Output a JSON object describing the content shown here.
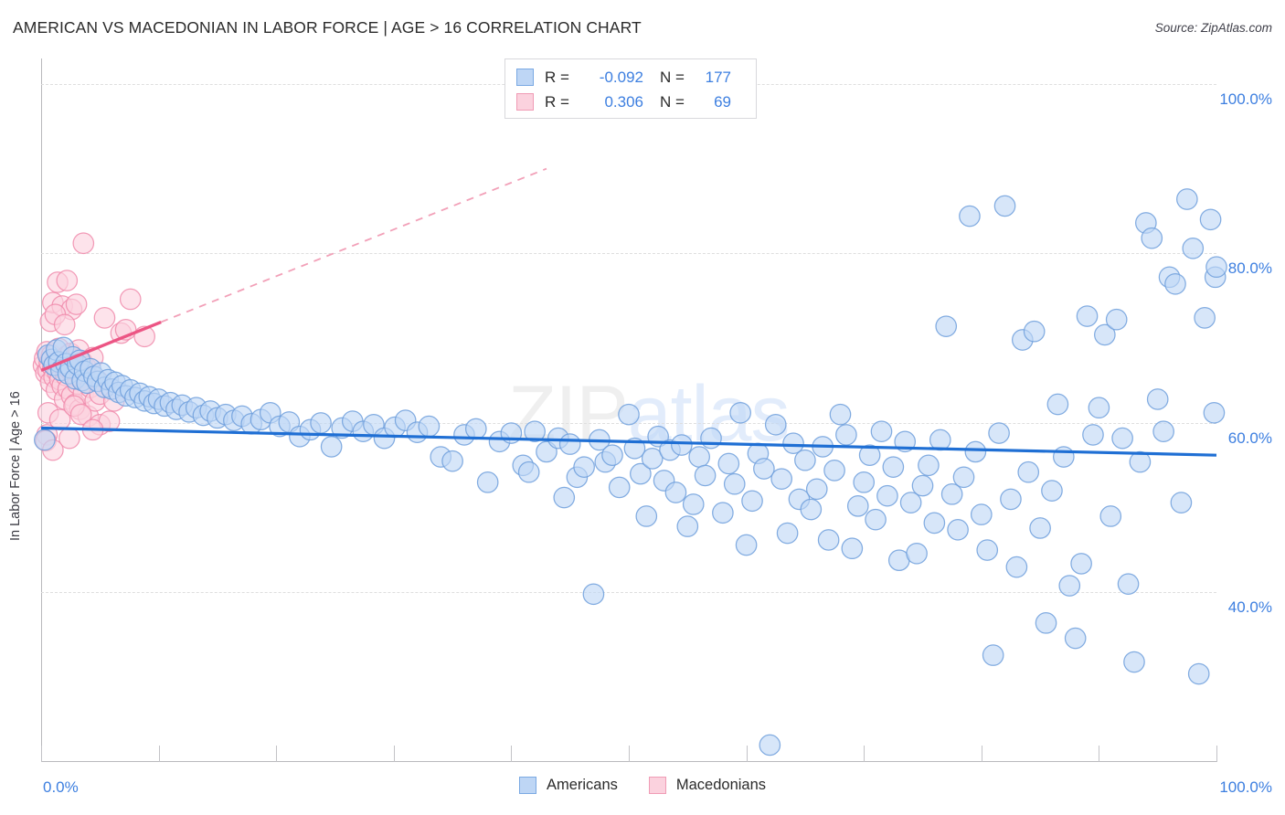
{
  "header": {
    "title": "AMERICAN VS MACEDONIAN IN LABOR FORCE | AGE > 16 CORRELATION CHART",
    "source": "Source: ZipAtlas.com"
  },
  "watermark": {
    "part1": "ZIP",
    "part2": "atlas"
  },
  "stats_legend": {
    "rows": [
      {
        "series": "Americans",
        "r_label": "R =",
        "r_value": "-0.092",
        "n_label": "N =",
        "n_value": "177",
        "color": "#bed6f5"
      },
      {
        "series": "Macedonians",
        "r_label": "R =",
        "r_value": "0.306",
        "n_label": "N =",
        "n_value": "69",
        "color": "#fbd2de"
      }
    ]
  },
  "bottom_legend": {
    "items": [
      {
        "label": "Americans",
        "color": "#bed6f5",
        "border": "#7aa9e3"
      },
      {
        "label": "Macedonians",
        "color": "#fbd2de",
        "border": "#f09bb5"
      }
    ]
  },
  "chart_data": {
    "type": "scatter",
    "title": "AMERICAN VS MACEDONIAN IN LABOR FORCE | AGE > 16 CORRELATION CHART",
    "xlabel": "",
    "ylabel": "In Labor Force | Age > 16",
    "xlim": [
      0,
      100
    ],
    "ylim": [
      20,
      103
    ],
    "grid": true,
    "x_tick_labels": [
      "0.0%",
      "100.0%"
    ],
    "y_tick_labels": [
      "100.0%",
      "80.0%",
      "60.0%",
      "40.0%"
    ],
    "y_ticks": [
      100,
      80,
      60,
      40
    ],
    "x_ticks": [
      0,
      10,
      20,
      30,
      40,
      50,
      60,
      70,
      80,
      90,
      100
    ],
    "legend_position": "bottom-center",
    "series": [
      {
        "name": "Americans",
        "color": "#bed6f5",
        "stroke": "#6f9fdc",
        "r": -0.092,
        "n": 177,
        "trendline": {
          "x0": 0,
          "y0": 59.4,
          "x1": 100,
          "y1": 56.2,
          "color": "#1f6fd4",
          "style": "solid"
        },
        "points": [
          [
            0.3,
            58.0
          ],
          [
            0.6,
            68.0
          ],
          [
            0.9,
            67.5
          ],
          [
            1.1,
            66.8
          ],
          [
            1.3,
            68.6
          ],
          [
            1.5,
            67.2
          ],
          [
            1.7,
            66.2
          ],
          [
            1.9,
            68.9
          ],
          [
            2.1,
            67.0
          ],
          [
            2.3,
            65.8
          ],
          [
            2.5,
            66.5
          ],
          [
            2.7,
            67.8
          ],
          [
            2.9,
            65.2
          ],
          [
            3.1,
            66.9
          ],
          [
            3.3,
            67.4
          ],
          [
            3.5,
            65.0
          ],
          [
            3.7,
            66.1
          ],
          [
            3.9,
            64.7
          ],
          [
            4.2,
            66.4
          ],
          [
            4.5,
            65.5
          ],
          [
            4.8,
            64.9
          ],
          [
            5.1,
            65.9
          ],
          [
            5.4,
            64.2
          ],
          [
            5.7,
            65.1
          ],
          [
            6.0,
            64.0
          ],
          [
            6.3,
            64.8
          ],
          [
            6.6,
            63.6
          ],
          [
            6.9,
            64.4
          ],
          [
            7.2,
            63.2
          ],
          [
            7.6,
            63.9
          ],
          [
            8.0,
            63.0
          ],
          [
            8.4,
            63.5
          ],
          [
            8.8,
            62.6
          ],
          [
            9.2,
            63.1
          ],
          [
            9.6,
            62.3
          ],
          [
            10.0,
            62.8
          ],
          [
            10.5,
            62.0
          ],
          [
            11.0,
            62.4
          ],
          [
            11.5,
            61.6
          ],
          [
            12.0,
            62.1
          ],
          [
            12.6,
            61.3
          ],
          [
            13.2,
            61.8
          ],
          [
            13.8,
            60.9
          ],
          [
            14.4,
            61.4
          ],
          [
            15.0,
            60.6
          ],
          [
            15.7,
            61.0
          ],
          [
            16.4,
            60.3
          ],
          [
            17.1,
            60.8
          ],
          [
            17.9,
            59.9
          ],
          [
            18.7,
            60.4
          ],
          [
            19.5,
            61.2
          ],
          [
            20.3,
            59.6
          ],
          [
            21.1,
            60.1
          ],
          [
            22.0,
            58.4
          ],
          [
            22.9,
            59.2
          ],
          [
            23.8,
            60.0
          ],
          [
            24.7,
            57.2
          ],
          [
            25.6,
            59.4
          ],
          [
            26.5,
            60.2
          ],
          [
            27.4,
            59.0
          ],
          [
            28.3,
            59.8
          ],
          [
            29.2,
            58.2
          ],
          [
            30.1,
            59.5
          ],
          [
            31.0,
            60.3
          ],
          [
            32.0,
            58.9
          ],
          [
            33.0,
            59.6
          ],
          [
            34.0,
            56.0
          ],
          [
            35.0,
            55.5
          ],
          [
            36.0,
            58.6
          ],
          [
            37.0,
            59.3
          ],
          [
            38.0,
            53.0
          ],
          [
            39.0,
            57.8
          ],
          [
            40.0,
            58.8
          ],
          [
            41.0,
            55.0
          ],
          [
            41.5,
            54.2
          ],
          [
            42.0,
            59.0
          ],
          [
            43.0,
            56.6
          ],
          [
            44.0,
            58.2
          ],
          [
            44.5,
            51.2
          ],
          [
            45.0,
            57.5
          ],
          [
            45.6,
            53.6
          ],
          [
            46.2,
            54.8
          ],
          [
            47.0,
            39.8
          ],
          [
            47.5,
            58.0
          ],
          [
            48.0,
            55.4
          ],
          [
            48.6,
            56.2
          ],
          [
            49.2,
            52.4
          ],
          [
            50.0,
            61.0
          ],
          [
            50.5,
            57.0
          ],
          [
            51.0,
            54.0
          ],
          [
            51.5,
            49.0
          ],
          [
            52.0,
            55.8
          ],
          [
            52.5,
            58.4
          ],
          [
            53.0,
            53.2
          ],
          [
            53.5,
            56.8
          ],
          [
            54.0,
            51.8
          ],
          [
            54.5,
            57.4
          ],
          [
            55.0,
            47.8
          ],
          [
            55.5,
            50.4
          ],
          [
            56.0,
            56.0
          ],
          [
            56.5,
            53.8
          ],
          [
            57.0,
            58.2
          ],
          [
            58.0,
            49.4
          ],
          [
            58.5,
            55.2
          ],
          [
            59.0,
            52.8
          ],
          [
            59.5,
            61.2
          ],
          [
            60.0,
            45.6
          ],
          [
            60.5,
            50.8
          ],
          [
            61.0,
            56.4
          ],
          [
            61.5,
            54.6
          ],
          [
            62.0,
            22.0
          ],
          [
            62.5,
            59.8
          ],
          [
            63.0,
            53.4
          ],
          [
            63.5,
            47.0
          ],
          [
            64.0,
            57.6
          ],
          [
            64.5,
            51.0
          ],
          [
            65.0,
            55.6
          ],
          [
            65.5,
            49.8
          ],
          [
            66.0,
            52.2
          ],
          [
            66.5,
            57.2
          ],
          [
            67.0,
            46.2
          ],
          [
            67.5,
            54.4
          ],
          [
            68.0,
            61.0
          ],
          [
            68.5,
            58.6
          ],
          [
            69.0,
            45.2
          ],
          [
            69.5,
            50.2
          ],
          [
            70.0,
            53.0
          ],
          [
            70.5,
            56.2
          ],
          [
            71.0,
            48.6
          ],
          [
            71.5,
            59.0
          ],
          [
            72.0,
            51.4
          ],
          [
            72.5,
            54.8
          ],
          [
            73.0,
            43.8
          ],
          [
            73.5,
            57.8
          ],
          [
            74.0,
            50.6
          ],
          [
            74.5,
            44.6
          ],
          [
            75.0,
            52.6
          ],
          [
            75.5,
            55.0
          ],
          [
            76.0,
            48.2
          ],
          [
            76.5,
            58.0
          ],
          [
            77.0,
            71.4
          ],
          [
            77.5,
            51.6
          ],
          [
            78.0,
            47.4
          ],
          [
            78.5,
            53.6
          ],
          [
            79.0,
            84.4
          ],
          [
            79.5,
            56.6
          ],
          [
            80.0,
            49.2
          ],
          [
            80.5,
            45.0
          ],
          [
            81.0,
            32.6
          ],
          [
            81.5,
            58.8
          ],
          [
            82.0,
            85.6
          ],
          [
            82.5,
            51.0
          ],
          [
            83.0,
            43.0
          ],
          [
            83.5,
            69.8
          ],
          [
            84.0,
            54.2
          ],
          [
            84.5,
            70.8
          ],
          [
            85.0,
            47.6
          ],
          [
            85.5,
            36.4
          ],
          [
            86.0,
            52.0
          ],
          [
            86.5,
            62.2
          ],
          [
            87.0,
            56.0
          ],
          [
            87.5,
            40.8
          ],
          [
            88.0,
            34.6
          ],
          [
            88.5,
            43.4
          ],
          [
            89.0,
            72.6
          ],
          [
            89.5,
            58.6
          ],
          [
            90.0,
            61.8
          ],
          [
            90.5,
            70.4
          ],
          [
            91.0,
            49.0
          ],
          [
            91.5,
            72.2
          ],
          [
            92.0,
            58.2
          ],
          [
            92.5,
            41.0
          ],
          [
            93.0,
            31.8
          ],
          [
            93.5,
            55.4
          ],
          [
            94.0,
            83.6
          ],
          [
            94.5,
            81.8
          ],
          [
            95.0,
            62.8
          ],
          [
            95.5,
            59.0
          ],
          [
            96.0,
            77.2
          ],
          [
            96.5,
            76.4
          ],
          [
            97.0,
            50.6
          ],
          [
            97.5,
            86.4
          ],
          [
            98.0,
            80.6
          ],
          [
            98.5,
            30.4
          ],
          [
            99.0,
            72.4
          ],
          [
            99.5,
            84.0
          ],
          [
            99.8,
            61.2
          ],
          [
            99.9,
            77.2
          ],
          [
            100.0,
            78.4
          ]
        ]
      },
      {
        "name": "Macedonians",
        "color": "#fbd2de",
        "stroke": "#f08bab",
        "r": 0.306,
        "n": 69,
        "trendline": {
          "x0": 0,
          "y0": 66.2,
          "x1": 10.2,
          "y1": 71.9,
          "color": "#ec5584",
          "style": "solid"
        },
        "trendline_extension": {
          "x0": 10.2,
          "y0": 71.9,
          "x1": 43.0,
          "y1": 90.0,
          "color": "#f2a0b8",
          "style": "dashed"
        },
        "points": [
          [
            0.2,
            66.8
          ],
          [
            0.3,
            67.6
          ],
          [
            0.4,
            65.9
          ],
          [
            0.5,
            68.4
          ],
          [
            0.6,
            66.2
          ],
          [
            0.7,
            67.1
          ],
          [
            0.8,
            64.8
          ],
          [
            0.9,
            68.0
          ],
          [
            1.0,
            66.5
          ],
          [
            1.1,
            65.4
          ],
          [
            1.2,
            67.3
          ],
          [
            1.3,
            63.9
          ],
          [
            1.4,
            66.0
          ],
          [
            1.5,
            68.8
          ],
          [
            1.6,
            65.1
          ],
          [
            1.7,
            67.0
          ],
          [
            1.8,
            64.4
          ],
          [
            1.9,
            66.7
          ],
          [
            2.0,
            62.8
          ],
          [
            2.1,
            65.6
          ],
          [
            2.2,
            67.9
          ],
          [
            2.3,
            64.0
          ],
          [
            2.4,
            66.3
          ],
          [
            2.5,
            68.2
          ],
          [
            2.6,
            63.2
          ],
          [
            2.7,
            65.8
          ],
          [
            2.8,
            67.5
          ],
          [
            2.9,
            62.2
          ],
          [
            3.0,
            66.1
          ],
          [
            3.1,
            64.6
          ],
          [
            3.2,
            68.6
          ],
          [
            3.3,
            61.6
          ],
          [
            3.4,
            65.3
          ],
          [
            3.5,
            67.2
          ],
          [
            3.6,
            63.5
          ],
          [
            3.8,
            66.6
          ],
          [
            4.0,
            60.8
          ],
          [
            4.2,
            64.2
          ],
          [
            4.4,
            67.7
          ],
          [
            4.6,
            62.6
          ],
          [
            4.8,
            65.0
          ],
          [
            5.0,
            59.8
          ],
          [
            0.5,
            58.6
          ],
          [
            0.8,
            72.0
          ],
          [
            1.0,
            74.2
          ],
          [
            1.4,
            76.6
          ],
          [
            2.2,
            76.8
          ],
          [
            1.8,
            73.8
          ],
          [
            2.6,
            73.4
          ],
          [
            3.6,
            81.2
          ],
          [
            3.0,
            74.0
          ],
          [
            5.4,
            72.4
          ],
          [
            7.6,
            74.6
          ],
          [
            1.2,
            72.8
          ],
          [
            2.0,
            71.6
          ],
          [
            0.6,
            61.2
          ],
          [
            1.6,
            60.4
          ],
          [
            2.8,
            62.0
          ],
          [
            3.4,
            61.0
          ],
          [
            5.0,
            63.4
          ],
          [
            6.2,
            62.6
          ],
          [
            5.8,
            60.2
          ],
          [
            4.4,
            59.2
          ],
          [
            0.4,
            57.9
          ],
          [
            2.4,
            58.2
          ],
          [
            1.0,
            56.8
          ],
          [
            6.8,
            70.6
          ],
          [
            7.2,
            71.0
          ],
          [
            8.8,
            70.2
          ]
        ]
      }
    ]
  }
}
